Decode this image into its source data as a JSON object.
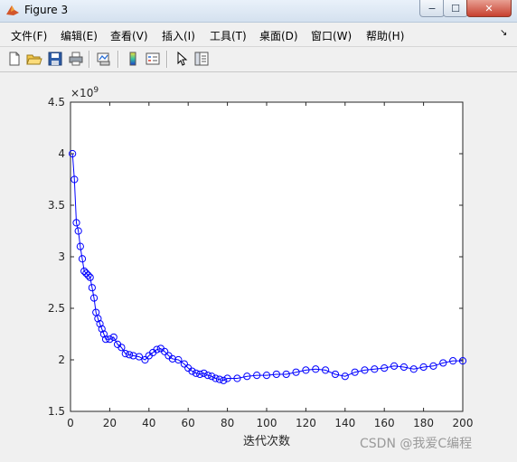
{
  "window": {
    "title": "Figure 3",
    "minimize_glyph": "−",
    "maximize_glyph": "☐",
    "close_glyph": "✕"
  },
  "menu": {
    "items": [
      "文件(F)",
      "编辑(E)",
      "查看(V)",
      "插入(I)",
      "工具(T)",
      "桌面(D)",
      "窗口(W)",
      "帮助(H)"
    ],
    "overflow_glyph": "↘"
  },
  "toolbar": {
    "icons": [
      "new-figure-icon",
      "open-file-icon",
      "save-icon",
      "print-icon",
      "link-plot-icon",
      "colorbar-icon",
      "legend-icon",
      "pointer-icon",
      "property-editor-icon"
    ]
  },
  "chart_data": {
    "type": "line",
    "xlabel": "迭代次数",
    "ylabel": "",
    "xlim": [
      0,
      200
    ],
    "ylim": [
      1.5,
      4.5
    ],
    "x_ticks": [
      "0",
      "20",
      "40",
      "60",
      "80",
      "100",
      "120",
      "140",
      "160",
      "180",
      "200"
    ],
    "y_ticks": [
      "1.5",
      "2",
      "2.5",
      "3",
      "3.5",
      "4",
      "4.5"
    ],
    "y_exponent": "×10^9",
    "marker": "circle",
    "color": "#0000ff",
    "series": [
      {
        "x": [
          1,
          2,
          3,
          4,
          5,
          6,
          7,
          8,
          9,
          10,
          11,
          12,
          13,
          14,
          15,
          16,
          17,
          18,
          20,
          22,
          24,
          26,
          28,
          30,
          32,
          35,
          38,
          40,
          42,
          44,
          46,
          48,
          50,
          52,
          55,
          58,
          60,
          62,
          64,
          66,
          68,
          70,
          72,
          74,
          76,
          78,
          80,
          85,
          90,
          95,
          100,
          105,
          110,
          115,
          120,
          125,
          130,
          135,
          140,
          145,
          150,
          155,
          160,
          165,
          170,
          175,
          180,
          185,
          190,
          195,
          200
        ],
        "y": [
          4.0,
          3.75,
          3.33,
          3.25,
          3.1,
          2.98,
          2.86,
          2.84,
          2.82,
          2.8,
          2.7,
          2.6,
          2.46,
          2.4,
          2.35,
          2.3,
          2.25,
          2.2,
          2.2,
          2.22,
          2.15,
          2.12,
          2.06,
          2.05,
          2.04,
          2.03,
          2.0,
          2.04,
          2.07,
          2.1,
          2.11,
          2.08,
          2.04,
          2.01,
          2.0,
          1.96,
          1.92,
          1.89,
          1.87,
          1.86,
          1.87,
          1.85,
          1.84,
          1.82,
          1.81,
          1.8,
          1.82,
          1.82,
          1.84,
          1.85,
          1.85,
          1.86,
          1.86,
          1.88,
          1.9,
          1.91,
          1.9,
          1.86,
          1.84,
          1.88,
          1.9,
          1.91,
          1.92,
          1.94,
          1.93,
          1.91,
          1.93,
          1.94,
          1.97,
          1.99,
          1.99
        ]
      }
    ]
  },
  "watermark": "CSDN @我爱C编程"
}
